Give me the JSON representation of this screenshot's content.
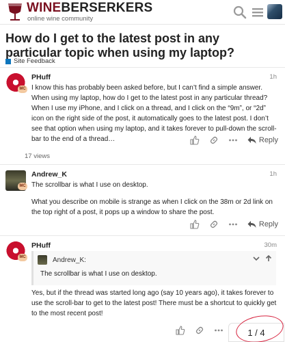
{
  "header": {
    "brand_wine": "WINE",
    "brand_berserkers": "BERSERKERS",
    "tagline": "online wine community"
  },
  "topic": {
    "title": "How do I get to the latest post in any particular topic when using my laptop?",
    "category": "Site Feedback",
    "category_color": "#0e76bd"
  },
  "posts": [
    {
      "username": "PHuff",
      "time": "1h",
      "body": "I know this has probably been asked before, but I can’t find a simple answer. When using my laptop, how do I get to the latest post in any particular thread? When I use my iPhone, and I click on a thread, and I click on the “9m”, or “2d” icon on the right side of the post, it automatically goes to the latest post. I don’t see that option when using my laptop, and it takes forever to pull-down the scroll-bar to the end of a thread…",
      "reply_label": "Reply",
      "views": "17 views"
    },
    {
      "username": "Andrew_K",
      "time": "1h",
      "body_p1": "The scrollbar is what I use on desktop.",
      "body_p2": "What you describe on mobile is strange as when I click on the 38m or 2d link on the top right of a post, it pops up a window to share the post.",
      "reply_label": "Reply"
    },
    {
      "username": "PHuff",
      "time": "30m",
      "quote_user": "Andrew_K:",
      "quote_text": "The scrollbar is what I use on desktop.",
      "body": "Yes, but if the thread was started long ago (say 10 years ago), it takes forever to use the scroll-bar to get to the latest post! There must be a shortcut to quickly get to the most recent post!",
      "reply_label": "Reply"
    }
  ],
  "progress": "1 / 4",
  "annotation_color": "#d6223e"
}
